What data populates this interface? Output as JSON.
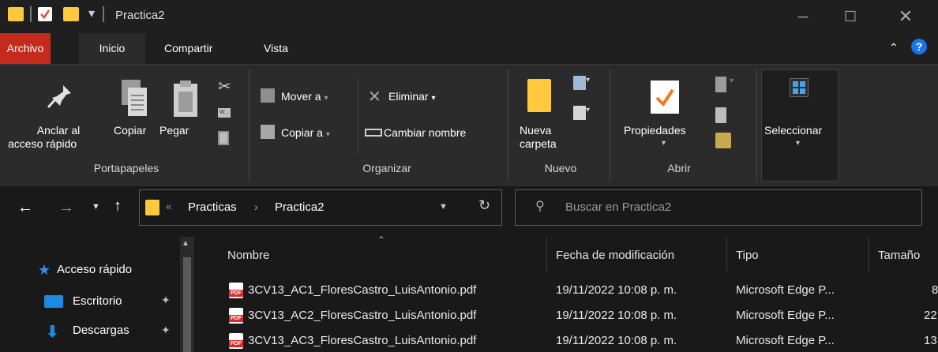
{
  "window": {
    "title": "Practica2"
  },
  "tabs": [
    {
      "label": "Archivo"
    },
    {
      "label": "Inicio"
    },
    {
      "label": "Compartir"
    },
    {
      "label": "Vista"
    }
  ],
  "ribbon": {
    "portapapeles": {
      "pin_label_1": "Anclar al",
      "pin_label_2": "acceso rápido",
      "copy_label": "Copiar",
      "paste_label": "Pegar",
      "group_label": "Portapapeles"
    },
    "organizar": {
      "move_label": "Mover a",
      "copy_to_label": "Copiar a",
      "delete_label": "Eliminar",
      "rename_label": "Cambiar nombre",
      "group_label": "Organizar"
    },
    "nuevo": {
      "new_folder_1": "Nueva",
      "new_folder_2": "carpeta",
      "group_label": "Nuevo"
    },
    "abrir": {
      "properties_label": "Propiedades",
      "group_label": "Abrir"
    },
    "seleccionar": {
      "label": "Seleccionar"
    }
  },
  "address": {
    "crumbs": [
      "Practicas",
      "Practica2"
    ],
    "search_placeholder": "Buscar en Practica2"
  },
  "nav_pane": [
    {
      "label": "Acceso rápido",
      "icon": "star-icon"
    },
    {
      "label": "Escritorio",
      "icon": "desktop-icon"
    },
    {
      "label": "Descargas",
      "icon": "download-icon"
    }
  ],
  "columns": [
    "Nombre",
    "Fecha de modificación",
    "Tipo",
    "Tamaño"
  ],
  "files": [
    {
      "name": "3CV13_AC1_FloresCastro_LuisAntonio.pdf",
      "date": "19/11/2022 10:08 p. m.",
      "type": "Microsoft Edge P...",
      "size": "8"
    },
    {
      "name": "3CV13_AC2_FloresCastro_LuisAntonio.pdf",
      "date": "19/11/2022 10:08 p. m.",
      "type": "Microsoft Edge P...",
      "size": "22"
    },
    {
      "name": "3CV13_AC3_FloresCastro_LuisAntonio.pdf",
      "date": "19/11/2022 10:08 p. m.",
      "type": "Microsoft Edge P...",
      "size": "13"
    }
  ],
  "colors": {
    "accent_file_tab": "#c42b1c",
    "folder": "#ffc83d",
    "help": "#1a73e8"
  }
}
